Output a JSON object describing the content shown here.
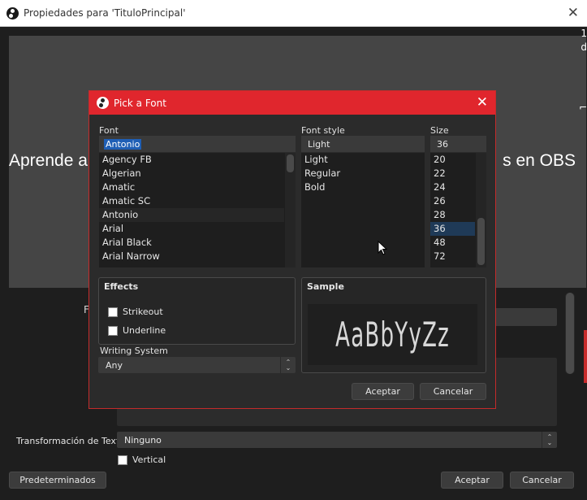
{
  "window": {
    "title": "Propiedades para 'TituloPrincipal'",
    "close_glyph": "✕"
  },
  "preview": {
    "text_left": "Aprende a",
    "text_right": "s en OBS"
  },
  "edge_glyphs": [
    "2",
    "1",
    "d",
    "⌐",
    "⌐",
    "⌐"
  ],
  "properties": {
    "font_label_partial": "F",
    "transform_label": "Transformación de Texto",
    "transform_value": "Ninguno",
    "vertical_label": "Vertical",
    "defaults_button": "Predeterminados",
    "accept_button": "Aceptar",
    "cancel_button": "Cancelar"
  },
  "dialog": {
    "title": "Pick a Font",
    "close_glyph": "✕",
    "font_label": "Font",
    "font_value": "Antonio",
    "fonts": [
      "Agency FB",
      "Algerian",
      "Amatic",
      "Amatic SC",
      "Antonio",
      "Arial",
      "Arial Black",
      "Arial Narrow"
    ],
    "style_label": "Font style",
    "style_value": "Light",
    "styles": [
      "Light",
      "Regular",
      "Bold"
    ],
    "size_label": "Size",
    "size_value": "36",
    "sizes": [
      "20",
      "22",
      "24",
      "26",
      "28",
      "36",
      "48",
      "72"
    ],
    "effects_title": "Effects",
    "strikeout_label": "Strikeout",
    "underline_label": "Underline",
    "writing_system_label": "Writing System",
    "writing_system_value": "Any",
    "sample_title": "Sample",
    "sample_text": "AaBbYyZz",
    "ok_button": "Aceptar",
    "cancel_button": "Cancelar"
  },
  "colors": {
    "accent_red": "#e0262d",
    "background": "#1e1e1e",
    "selection": "#1f3a57"
  }
}
